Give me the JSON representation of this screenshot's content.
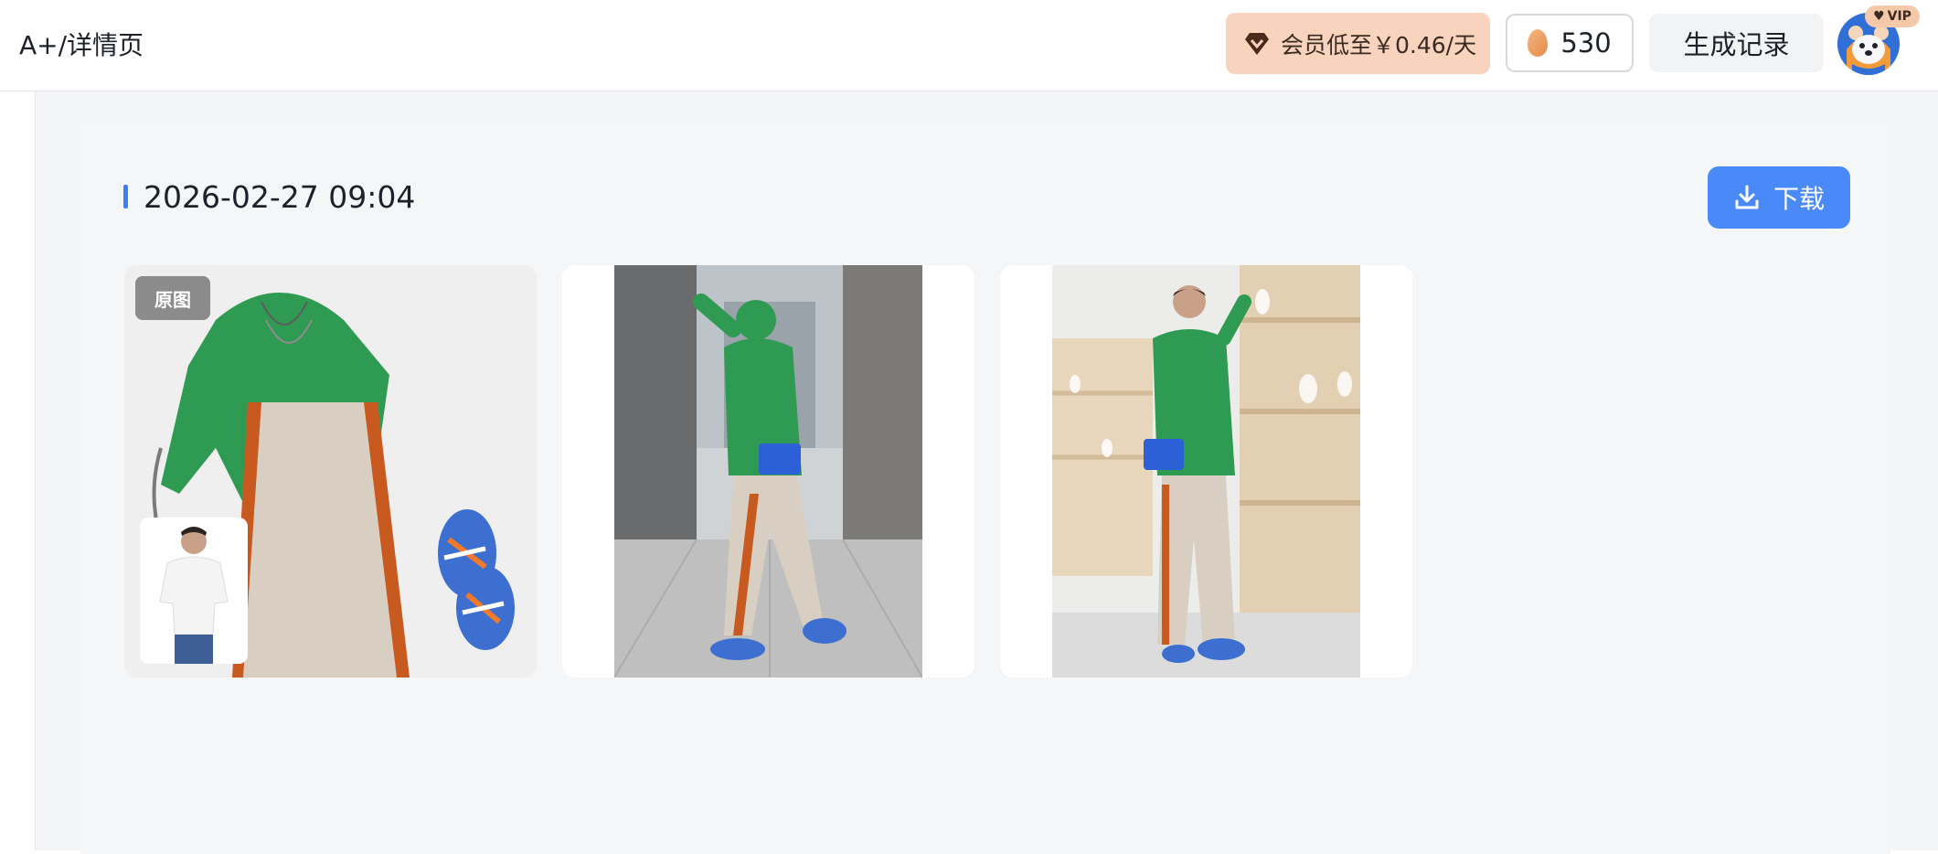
{
  "header": {
    "breadcrumb": "A+/详情页",
    "vip_promo": "会员低至￥0.46/天",
    "points": "530",
    "history_label": "生成记录",
    "vip_badge": "VIP"
  },
  "result": {
    "timestamp": "2026-02-27 09:04",
    "download_label": "下载",
    "original_badge": "原图"
  },
  "colors": {
    "accent": "#4a8af8",
    "promo_bg": "#f8d4bf",
    "panel_bg": "#f4f5f7"
  },
  "icons": {
    "promo": "diamond-icon",
    "points": "egg-icon",
    "download": "download-icon"
  }
}
